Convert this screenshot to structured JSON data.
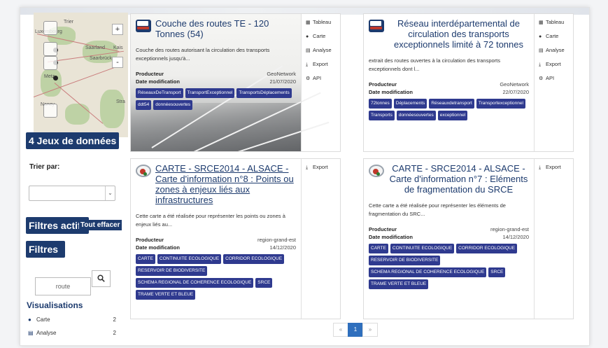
{
  "sidebar": {
    "map": {
      "cities": [
        "Trier",
        "Luxembourg",
        "Saarland",
        "Kais",
        "Saarbrücken",
        "Metz",
        "Nancy",
        "Stra"
      ],
      "zoom_in": "+",
      "zoom_out": "-"
    },
    "dataset_count": "4 Jeux de données",
    "sort_label": "Trier par:",
    "sort_selected": "",
    "active_filters_title": "Filtres actifs",
    "clear_all": "Tout effacer",
    "filters_title": "Filtres",
    "search_value": "route",
    "facet_title": "Visualisations",
    "facets": [
      {
        "icon": "globe-icon",
        "label": "Carte",
        "count": "2"
      },
      {
        "icon": "chart-icon",
        "label": "Analyse",
        "count": "2"
      }
    ]
  },
  "cards": [
    {
      "title": "Couche des routes TE - 120 Tonnes (54)",
      "description": "Couche des routes autorisant la circulation des transports exceptionnels jusqu'à...",
      "producer_label": "Producteur",
      "producer": "GeoNetwork",
      "date_label": "Date modification",
      "date": "21/07/2020",
      "tags": [
        "RéseauxDeTransport",
        "TransportExceptionnel",
        "TransportsDéplacements",
        "ddt54",
        "donnéesouvertes"
      ],
      "actions": [
        {
          "icon": "table-icon",
          "label": "Tableau"
        },
        {
          "icon": "globe-icon",
          "label": "Carte"
        },
        {
          "icon": "chart-icon",
          "label": "Analyse"
        },
        {
          "icon": "download-icon",
          "label": "Export"
        },
        {
          "icon": "cogs-icon",
          "label": "API"
        }
      ]
    },
    {
      "title": "Réseau interdépartemental de circulation des transports exceptionnels limité à 72 tonnes",
      "description": "extrait des routes ouvertes à la circulation des transports exceptionnels dont l...",
      "producer_label": "Producteur",
      "producer": "GeoNetwork",
      "date_label": "Date modification",
      "date": "22/07/2020",
      "tags": [
        "72tonnes",
        "Déplacements",
        "Réseauxdetransport",
        "Transportexceptionnel",
        "Transports",
        "donnéesouvertes",
        "exceptionnel"
      ],
      "actions": [
        {
          "icon": "table-icon",
          "label": "Tableau"
        },
        {
          "icon": "globe-icon",
          "label": "Carte"
        },
        {
          "icon": "chart-icon",
          "label": "Analyse"
        },
        {
          "icon": "download-icon",
          "label": "Export"
        },
        {
          "icon": "cogs-icon",
          "label": "API"
        }
      ]
    },
    {
      "title": "CARTE - SRCE2014 - ALSACE - Carte d'information n°8 : Points ou zones à enjeux liés aux infrastructures",
      "description": "Cette carte a été réalisée pour représenter les points ou zones à enjeux liés au...",
      "producer_label": "Producteur",
      "producer": "region-grand-est",
      "date_label": "Date modification",
      "date": "14/12/2020",
      "tags": [
        "CARTE",
        "CONTINUITE ECOLOGIQUE",
        "CORRIDOR ECOLOGIQUE",
        "RESERVOIR DE BIODIVERSITE",
        "SCHEMA REGIONAL DE COHERENCE ECOLOGIQUE",
        "SRCE",
        "TRAME VERTE ET BLEUE"
      ],
      "actions": [
        {
          "icon": "download-icon",
          "label": "Export"
        }
      ]
    },
    {
      "title": "CARTE - SRCE2014 - ALSACE - Carte d'information n°7 : Eléments de fragmentation du SRCE",
      "description": "Cette carte a été réalisée pour représenter les éléments de fragmentation du SRC...",
      "producer_label": "Producteur",
      "producer": "region-grand-est",
      "date_label": "Date modification",
      "date": "14/12/2020",
      "tags": [
        "CARTE",
        "CONTINUITE ECOLOGIQUE",
        "CORRIDOR ECOLOGIQUE",
        "RESERVOIR DE BIODIVERSITE",
        "SCHEMA REGIONAL DE COHERENCE ECOLOGIQUE",
        "SRCE",
        "TRAME VERTE ET BLEUE"
      ],
      "actions": [
        {
          "icon": "download-icon",
          "label": "Export"
        }
      ]
    }
  ],
  "pagination": {
    "prev": "«",
    "current": "1",
    "next": "»"
  },
  "colors": {
    "primary": "#1d3b6e",
    "tag": "#2f3a8f",
    "page_active": "#2f6fbd"
  }
}
